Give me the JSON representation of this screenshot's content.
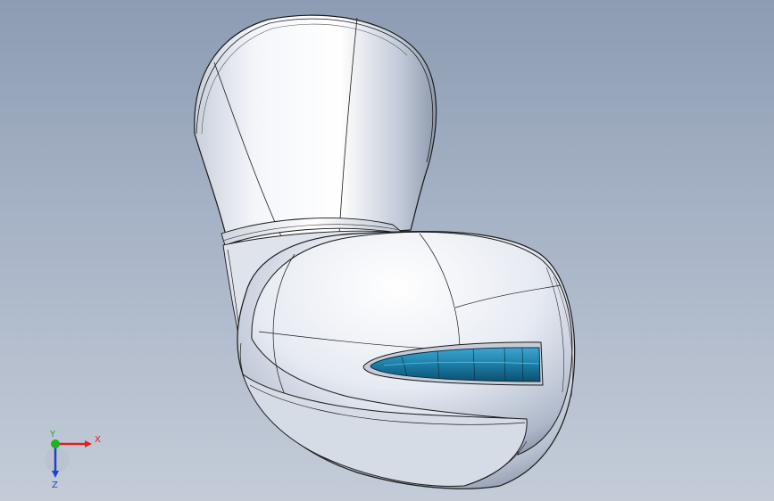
{
  "viewport": {
    "background_top": "#8d9cb3",
    "background_bottom": "#c4ccd8"
  },
  "model": {
    "part_name": "",
    "body_color": "#eef1f7",
    "edge_color": "#1a1a1a",
    "insert_color": "#1f7fa6"
  },
  "triad": {
    "x_label": "X",
    "y_label": "Y",
    "z_label": "Z",
    "x_color": "#e02020",
    "y_color": "#20b020",
    "z_color": "#2040d0"
  }
}
